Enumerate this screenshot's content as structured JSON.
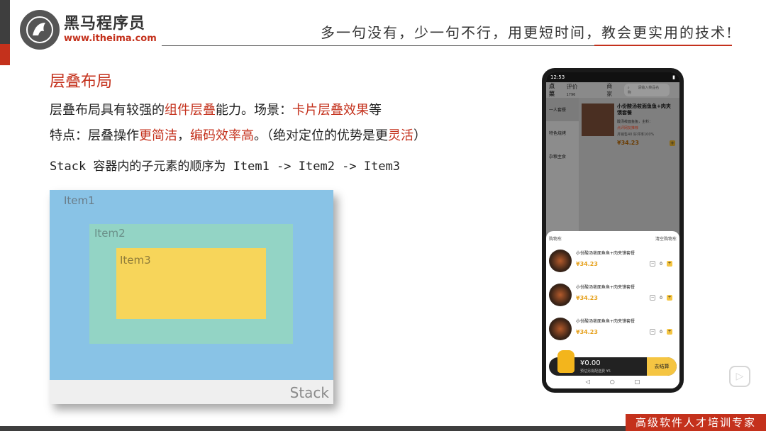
{
  "logo": {
    "name_cn": "黑马程序员",
    "url": "www.itheima.com"
  },
  "slogan": "多一句没有，少一句不行，用更短时间，教会更实用的技术!",
  "slide": {
    "title": "层叠布局",
    "line1": {
      "a": "层叠布局具有较强的",
      "b": "组件层叠",
      "c": "能力。场景：",
      "d": "卡片层叠效果",
      "e": "等"
    },
    "line2": {
      "a": "特点：层叠操作",
      "b": "更简洁",
      "c": "，",
      "d": "编码效率高",
      "e": "。（绝对定位的优势是更",
      "f": "灵活",
      "g": "）"
    },
    "line3": "Stack 容器内的子元素的顺序为 Item1 -> Item2 -> Item3"
  },
  "stack_demo": {
    "item1": "Item1",
    "item2": "Item2",
    "item3": "Item3",
    "container": "Stack",
    "colors": {
      "item1": "#89c3e6",
      "item2": "#93d4c5",
      "item3": "#f7d55a",
      "container": "#efefef"
    }
  },
  "phone": {
    "time": "12:53",
    "tabs": [
      "点菜",
      "评价",
      "商家"
    ],
    "review_count": "1796",
    "search_placeholder": "请输入菜品名称",
    "categories": [
      "一人套餐",
      "特色烧烤",
      "杂粮主食"
    ],
    "food": {
      "name": "小份酸汤莜面鱼鱼+肉夹馍套餐",
      "sub": "酸汤莜面鱼鱼，主料：",
      "tag": "点评网友推荐",
      "sales": "月销售40 好评率100%",
      "price": "34.23"
    },
    "cart": {
      "title": "购物车",
      "clear": "清空购物车",
      "items": [
        {
          "name": "小份酸汤莜面鱼鱼+肉夹馍套餐",
          "price": "34.23",
          "qty": "0"
        },
        {
          "name": "小份酸汤莜面鱼鱼+肉夹馍套餐",
          "price": "34.23",
          "qty": "0"
        },
        {
          "name": "小份酸汤莜面鱼鱼+肉夹馍套餐",
          "price": "34.23",
          "qty": "0"
        }
      ],
      "total": "0.00",
      "fee": "预估另需配送费 ¥5",
      "checkout": "去结算"
    }
  },
  "footer": {
    "banner": "高级软件人才培训专家"
  }
}
